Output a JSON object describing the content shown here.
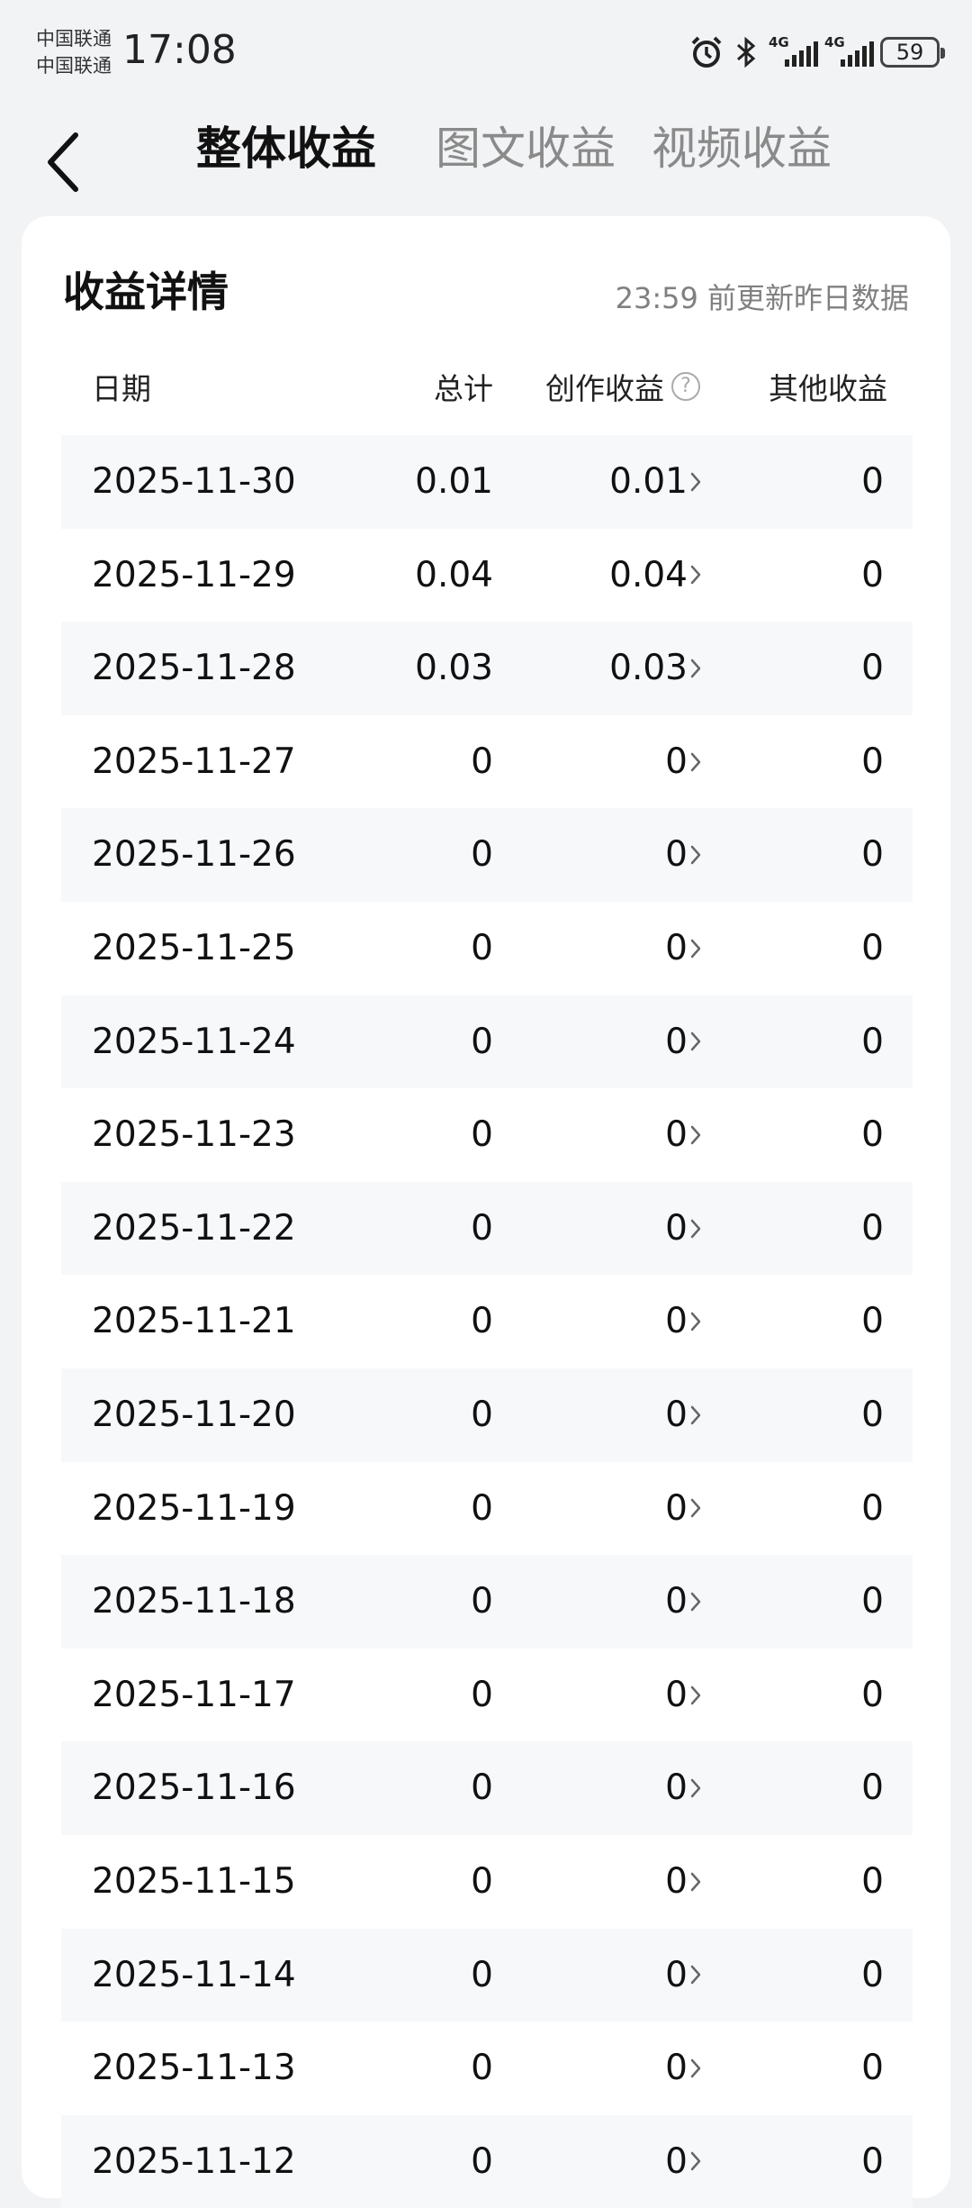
{
  "status_bar": {
    "carrier1": "中国联通",
    "carrier2": "中国联通",
    "time": "17:08",
    "net1": "4G",
    "net2": "4G",
    "battery": "59"
  },
  "tabs": [
    {
      "label": "整体收益",
      "active": true
    },
    {
      "label": "图文收益",
      "active": false
    },
    {
      "label": "视频收益",
      "active": false
    }
  ],
  "card": {
    "title": "收益详情",
    "update_note": "23:59 前更新昨日数据"
  },
  "table": {
    "headers": [
      "日期",
      "总计",
      "创作收益",
      "其他收益"
    ],
    "help_icon_glyph": "?",
    "rows": [
      {
        "date": "2025-11-30",
        "total": "0.01",
        "creation": "0.01",
        "other": "0"
      },
      {
        "date": "2025-11-29",
        "total": "0.04",
        "creation": "0.04",
        "other": "0"
      },
      {
        "date": "2025-11-28",
        "total": "0.03",
        "creation": "0.03",
        "other": "0"
      },
      {
        "date": "2025-11-27",
        "total": "0",
        "creation": "0",
        "other": "0"
      },
      {
        "date": "2025-11-26",
        "total": "0",
        "creation": "0",
        "other": "0"
      },
      {
        "date": "2025-11-25",
        "total": "0",
        "creation": "0",
        "other": "0"
      },
      {
        "date": "2025-11-24",
        "total": "0",
        "creation": "0",
        "other": "0"
      },
      {
        "date": "2025-11-23",
        "total": "0",
        "creation": "0",
        "other": "0"
      },
      {
        "date": "2025-11-22",
        "total": "0",
        "creation": "0",
        "other": "0"
      },
      {
        "date": "2025-11-21",
        "total": "0",
        "creation": "0",
        "other": "0"
      },
      {
        "date": "2025-11-20",
        "total": "0",
        "creation": "0",
        "other": "0"
      },
      {
        "date": "2025-11-19",
        "total": "0",
        "creation": "0",
        "other": "0"
      },
      {
        "date": "2025-11-18",
        "total": "0",
        "creation": "0",
        "other": "0"
      },
      {
        "date": "2025-11-17",
        "total": "0",
        "creation": "0",
        "other": "0"
      },
      {
        "date": "2025-11-16",
        "total": "0",
        "creation": "0",
        "other": "0"
      },
      {
        "date": "2025-11-15",
        "total": "0",
        "creation": "0",
        "other": "0"
      },
      {
        "date": "2025-11-14",
        "total": "0",
        "creation": "0",
        "other": "0"
      },
      {
        "date": "2025-11-13",
        "total": "0",
        "creation": "0",
        "other": "0"
      },
      {
        "date": "2025-11-12",
        "total": "0",
        "creation": "0",
        "other": "0"
      }
    ]
  }
}
